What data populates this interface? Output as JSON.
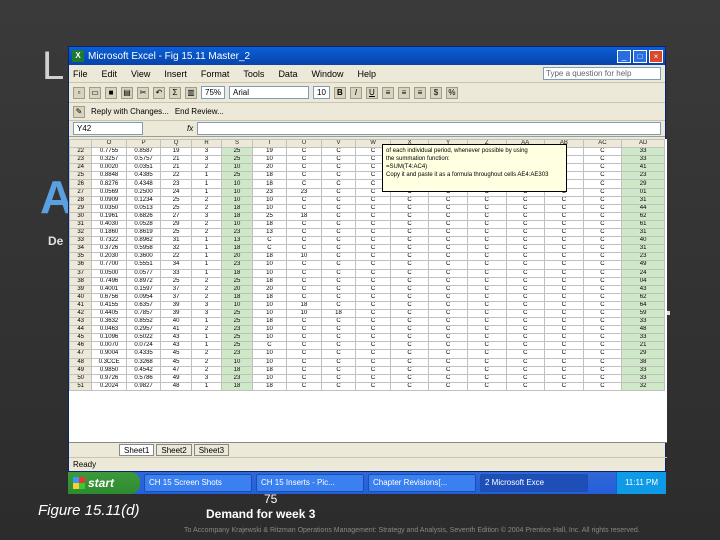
{
  "slide": {
    "title_fragment": "L",
    "left_glyph": "A",
    "right_glyph": "-",
    "right_glyph2": "-",
    "de_fragment": "De",
    "figure_label": "Figure 15.11(d)",
    "number": "75",
    "demand_label": "Demand for week 3",
    "footer": "To Accompany Krajewski & Ritzman Operations Management: Strategy and Analysis, Seventh Edition © 2004 Prentice Hall, Inc. All rights reserved."
  },
  "window": {
    "title": "Microsoft Excel - Fig 15.11 Master_2",
    "menu": [
      "File",
      "Edit",
      "View",
      "Insert",
      "Format",
      "Tools",
      "Data",
      "Window",
      "Help"
    ],
    "help_placeholder": "Type a question for help",
    "zoom": "75%",
    "font": "Arial",
    "font_size": "10",
    "reply_text": "Reply with Changes...",
    "end_review": "End Review...",
    "name_box": "Y42",
    "fx": "fx"
  },
  "grid": {
    "columns": [
      "",
      "O",
      "P",
      "Q",
      "R",
      "S",
      "T",
      "U",
      "V",
      "W",
      "X",
      "Y",
      "Z",
      "AA",
      "AB",
      "AC",
      "AD"
    ],
    "rows": [
      [
        "22",
        "0.7755",
        "0.8587",
        "19",
        "3",
        "25",
        "19",
        "C",
        "C",
        "C",
        "C",
        "C",
        "C",
        "C",
        "C",
        "C",
        "33"
      ],
      [
        "23",
        "0.3257",
        "0.5757",
        "21",
        "3",
        "25",
        "10",
        "C",
        "C",
        "C",
        "C",
        "C",
        "C",
        "C",
        "C",
        "C",
        "33"
      ],
      [
        "24",
        "0.0020",
        "0.0351",
        "21",
        "2",
        "10",
        "20",
        "C",
        "C",
        "C",
        "C",
        "C",
        "C",
        "C",
        "C",
        "C",
        "41"
      ],
      [
        "25",
        "0.8848",
        "0.4385",
        "22",
        "1",
        "25",
        "18",
        "C",
        "C",
        "C",
        "C",
        "C",
        "C",
        "C",
        "C",
        "C",
        "23"
      ],
      [
        "26",
        "0.8276",
        "0.4348",
        "23",
        "1",
        "10",
        "18",
        "C",
        "C",
        "C",
        "C",
        "C",
        "C",
        "C",
        "C",
        "C",
        "29"
      ],
      [
        "27",
        "0.0569",
        "0.2500",
        "24",
        "1",
        "10",
        "23",
        "23",
        "C",
        "C",
        "C",
        "C",
        "C",
        "C",
        "C",
        "C",
        "01"
      ],
      [
        "28",
        "0.0909",
        "0.1234",
        "25",
        "2",
        "10",
        "10",
        "C",
        "C",
        "C",
        "C",
        "C",
        "C",
        "C",
        "C",
        "C",
        "31"
      ],
      [
        "29",
        "0.0350",
        "0.0513",
        "25",
        "2",
        "18",
        "10",
        "C",
        "C",
        "C",
        "C",
        "C",
        "C",
        "C",
        "C",
        "C",
        "44"
      ],
      [
        "30",
        "0.1961",
        "0.6826",
        "27",
        "3",
        "18",
        "25",
        "18",
        "C",
        "C",
        "C",
        "C",
        "C",
        "C",
        "C",
        "C",
        "62"
      ],
      [
        "31",
        "0.4030",
        "0.0528",
        "29",
        "2",
        "10",
        "18",
        "C",
        "C",
        "C",
        "C",
        "C",
        "C",
        "C",
        "C",
        "C",
        "61"
      ],
      [
        "32",
        "0.1860",
        "0.8619",
        "25",
        "2",
        "23",
        "13",
        "C",
        "C",
        "C",
        "C",
        "C",
        "C",
        "C",
        "C",
        "C",
        "31"
      ],
      [
        "33",
        "0.7322",
        "0.8962",
        "31",
        "1",
        "13",
        "C",
        "C",
        "C",
        "C",
        "C",
        "C",
        "C",
        "C",
        "C",
        "C",
        "40"
      ],
      [
        "34",
        "0.3726",
        "0.5958",
        "32",
        "1",
        "18",
        "C",
        "C",
        "C",
        "C",
        "C",
        "C",
        "C",
        "C",
        "C",
        "C",
        "31"
      ],
      [
        "35",
        "0.2030",
        "0.3600",
        "22",
        "1",
        "20",
        "18",
        "10",
        "C",
        "C",
        "C",
        "C",
        "C",
        "C",
        "C",
        "C",
        "23"
      ],
      [
        "36",
        "0.7700",
        "0.5551",
        "34",
        "1",
        "23",
        "10",
        "C",
        "C",
        "C",
        "C",
        "C",
        "C",
        "C",
        "C",
        "C",
        "49"
      ],
      [
        "37",
        "0.0500",
        "0.0577",
        "33",
        "1",
        "18",
        "10",
        "C",
        "C",
        "C",
        "C",
        "C",
        "C",
        "C",
        "C",
        "C",
        "24"
      ],
      [
        "38",
        "0.7496",
        "0.8972",
        "25",
        "2",
        "25",
        "18",
        "C",
        "C",
        "C",
        "C",
        "C",
        "C",
        "C",
        "C",
        "C",
        "04"
      ],
      [
        "39",
        "0.4001",
        "0.1597",
        "37",
        "2",
        "20",
        "20",
        "C",
        "C",
        "C",
        "C",
        "C",
        "C",
        "C",
        "C",
        "C",
        "43"
      ],
      [
        "40",
        "0.6756",
        "0.0954",
        "37",
        "2",
        "18",
        "18",
        "C",
        "C",
        "C",
        "C",
        "C",
        "C",
        "C",
        "C",
        "C",
        "62"
      ],
      [
        "41",
        "0.4155",
        "0.6357",
        "39",
        "3",
        "10",
        "10",
        "18",
        "C",
        "C",
        "C",
        "C",
        "C",
        "C",
        "C",
        "C",
        "64"
      ],
      [
        "42",
        "0.4405",
        "0.7857",
        "39",
        "3",
        "25",
        "10",
        "10",
        "18",
        "C",
        "C",
        "C",
        "C",
        "C",
        "C",
        "C",
        "59"
      ],
      [
        "43",
        "0.3632",
        "0.8552",
        "40",
        "1",
        "25",
        "18",
        "C",
        "C",
        "C",
        "C",
        "C",
        "C",
        "C",
        "C",
        "C",
        "33"
      ],
      [
        "44",
        "0.0463",
        "0.2957",
        "41",
        "2",
        "23",
        "10",
        "C",
        "C",
        "C",
        "C",
        "C",
        "C",
        "C",
        "C",
        "C",
        "48"
      ],
      [
        "45",
        "0.1096",
        "0.5022",
        "43",
        "1",
        "25",
        "10",
        "C",
        "C",
        "C",
        "C",
        "C",
        "C",
        "C",
        "C",
        "C",
        "33"
      ],
      [
        "46",
        "0.0070",
        "0.0724",
        "43",
        "1",
        "25",
        "C",
        "C",
        "C",
        "C",
        "C",
        "C",
        "C",
        "C",
        "C",
        "C",
        "21"
      ],
      [
        "47",
        "0.9004",
        "0.4335",
        "45",
        "2",
        "23",
        "10",
        "C",
        "C",
        "C",
        "C",
        "C",
        "C",
        "C",
        "C",
        "C",
        "29"
      ],
      [
        "48",
        "0.3CCE",
        "0.3268",
        "45",
        "2",
        "10",
        "10",
        "C",
        "C",
        "C",
        "C",
        "C",
        "C",
        "C",
        "C",
        "C",
        "38"
      ],
      [
        "49",
        "0.9850",
        "0.4542",
        "47",
        "2",
        "18",
        "18",
        "C",
        "C",
        "C",
        "C",
        "C",
        "C",
        "C",
        "C",
        "C",
        "33"
      ],
      [
        "50",
        "0.9726",
        "0.5786",
        "49",
        "3",
        "23",
        "10",
        "C",
        "C",
        "C",
        "C",
        "C",
        "C",
        "C",
        "C",
        "C",
        "33"
      ],
      [
        "51",
        "0.2024",
        "0.9827",
        "48",
        "1",
        "18",
        "18",
        "C",
        "C",
        "C",
        "C",
        "C",
        "C",
        "C",
        "C",
        "C",
        "32"
      ]
    ]
  },
  "comment": {
    "lines": [
      "of each individual period, whenever possible by using",
      "the summation function:",
      "=SUM(T4:AC4)",
      "Copy it and paste it as a formula throughout cells AE4:AE303"
    ]
  },
  "tabs": [
    "Sheet1",
    "Sheet2",
    "Sheet3"
  ],
  "status": "Ready",
  "taskbar": {
    "start": "start",
    "tasks": [
      "CH 15 Screen Shots",
      "CH 15 Inserts - Pic...",
      "Chapter Revisions[...",
      "2 Microsoft Exce"
    ],
    "clock": "11:11 PM"
  }
}
